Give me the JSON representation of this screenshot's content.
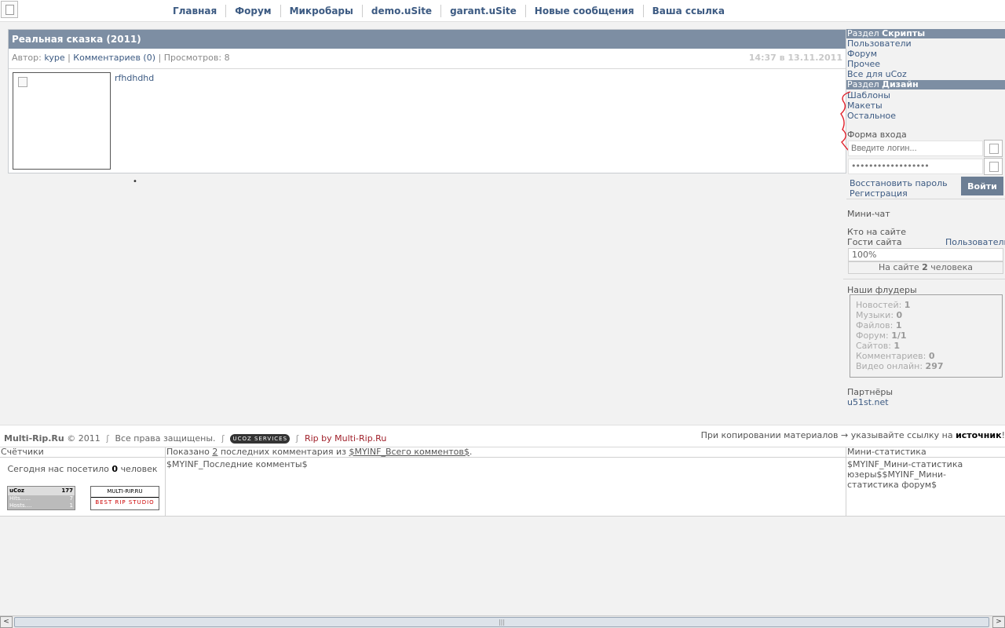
{
  "topnav": [
    "Главная",
    "Форум",
    "Микробары",
    "demo.uSite",
    "garant.uSite",
    "Новые сообщения",
    "Ваша ссылка"
  ],
  "post": {
    "title": "Реальная сказка (2011)",
    "author_label": "Автор:",
    "author": "kype",
    "comments": "Комментариев (0)",
    "views": "Просмотров: 8",
    "date": "14:37 в 13.11.2011",
    "text": "rfhdhdhd"
  },
  "sidebar": {
    "section1_prefix": "Раздел",
    "section1_name": "Скрипты",
    "section1_links": [
      "Пользователи",
      "Форум",
      "Прочее",
      "Все для uCoz"
    ],
    "section2_prefix": "Раздел",
    "section2_name": "Дизайн",
    "section2_links": [
      "Шаблоны",
      "Макеты",
      "Остальное"
    ],
    "login_title": "Форма входа",
    "login_placeholder": "Введите логин...",
    "password_value": "••••••••••••••••••",
    "restore_link": "Восстановить пароль",
    "register_link": "Регистрация",
    "login_button": "Войти",
    "minichat": "Мини-чат",
    "who_online": "Кто на сайте",
    "guests": "Гости сайта",
    "users": "Пользователи",
    "percent": "100%",
    "online_prefix": "На сайте",
    "online_count": "2",
    "online_suffix": "человека",
    "flooders_title": "Наши флудеры",
    "stats": [
      {
        "label": "Новостей:",
        "value": "1"
      },
      {
        "label": "Музыки:",
        "value": "0"
      },
      {
        "label": "Файлов:",
        "value": "1"
      },
      {
        "label": "Форум:",
        "value": "1/1"
      },
      {
        "label": "Сайтов:",
        "value": "1"
      },
      {
        "label": "Комментариев:",
        "value": "0"
      },
      {
        "label": "Видео онлайн:",
        "value": "297"
      }
    ],
    "partners_title": "Партнёры",
    "partner_link": "u51st.net"
  },
  "footer": {
    "brand": "Multi-Rip.Ru",
    "copyright": "© 2011",
    "rights": "Все права защищены.",
    "ucoz_badge": "UCOZ SERVICES",
    "rip_by": "Rip by Multi-Rip.Ru",
    "copy_notice": "При копировании материалов → указывайте ссылку на",
    "copy_source": "источник",
    "copy_end": "!"
  },
  "bottom": {
    "counters_title": "Счётчики",
    "visits_prefix": "Сегодня нас посетило",
    "visits_count": "0",
    "visits_suffix": "человек",
    "ucoz_counter": {
      "brand": "uCoz",
      "total": "177",
      "hits_label": "Hits......",
      "hits": "7",
      "hosts_label": "Hosts....",
      "hosts": "1"
    },
    "rip_counter": {
      "line1": "MULTI-RIP.RU",
      "line2": "BEST RIP STUDIO"
    },
    "comments_head_prefix": "Показано",
    "comments_head_count": "2",
    "comments_head_mid": "последних комментария из",
    "comments_head_var": "$MYINF_Всего комментов$",
    "comments_head_end": ".",
    "comments_body": "$MYINF_Последние комменты$",
    "ministat_title": "Мини-статистика",
    "ministat_body": "$MYINF_Мини-статистика юзеры$$MYINF_Мини-статистика форум$"
  },
  "scrollbar": {
    "left": "<",
    "right": ">",
    "grip": "|||"
  }
}
